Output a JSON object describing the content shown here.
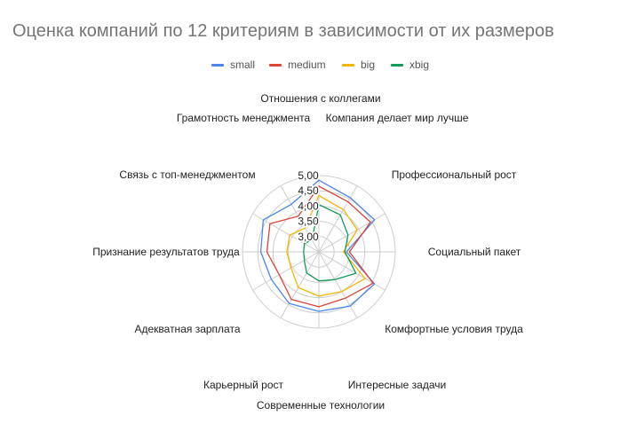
{
  "chart_data": {
    "type": "radar",
    "title": "Оценка компаний по 12 критериям в зависимости от их размеров",
    "categories": [
      "Отношения с коллегами",
      "Компания делает мир лучше",
      "Профессиональный рост",
      "Социальный пакет",
      "Комфортные условия труда",
      "Интересные задачи",
      "Современные технологии",
      "Карьерный рост",
      "Адекватная зарплата",
      "Признание результатов труда",
      "Связь с топ-менеджментом",
      "Грамотность менеджмента"
    ],
    "r_ticks": [
      "3,00",
      "3,50",
      "4,00",
      "4,50",
      "5,00"
    ],
    "rlim": [
      2.5,
      5.0
    ],
    "grid": true,
    "legend_position": "top",
    "series": [
      {
        "name": "small",
        "color": "#4a86e8",
        "values": [
          4.85,
          4.55,
          4.6,
          3.4,
          4.6,
          4.55,
          4.45,
          4.45,
          4.3,
          4.4,
          4.6,
          4.3
        ]
      },
      {
        "name": "medium",
        "color": "#db4437",
        "values": [
          4.65,
          4.4,
          4.45,
          3.5,
          4.55,
          4.25,
          4.3,
          4.3,
          4.0,
          4.2,
          4.35,
          3.85
        ]
      },
      {
        "name": "big",
        "color": "#f4b400",
        "values": [
          4.35,
          4.1,
          3.95,
          3.3,
          4.25,
          4.0,
          3.95,
          3.85,
          3.55,
          3.55,
          3.6,
          3.4
        ]
      },
      {
        "name": "xbig",
        "color": "#0f9d58",
        "values": [
          4.05,
          3.9,
          3.6,
          3.35,
          3.9,
          3.55,
          3.45,
          3.3,
          3.05,
          3.0,
          3.05,
          2.95
        ]
      }
    ]
  }
}
